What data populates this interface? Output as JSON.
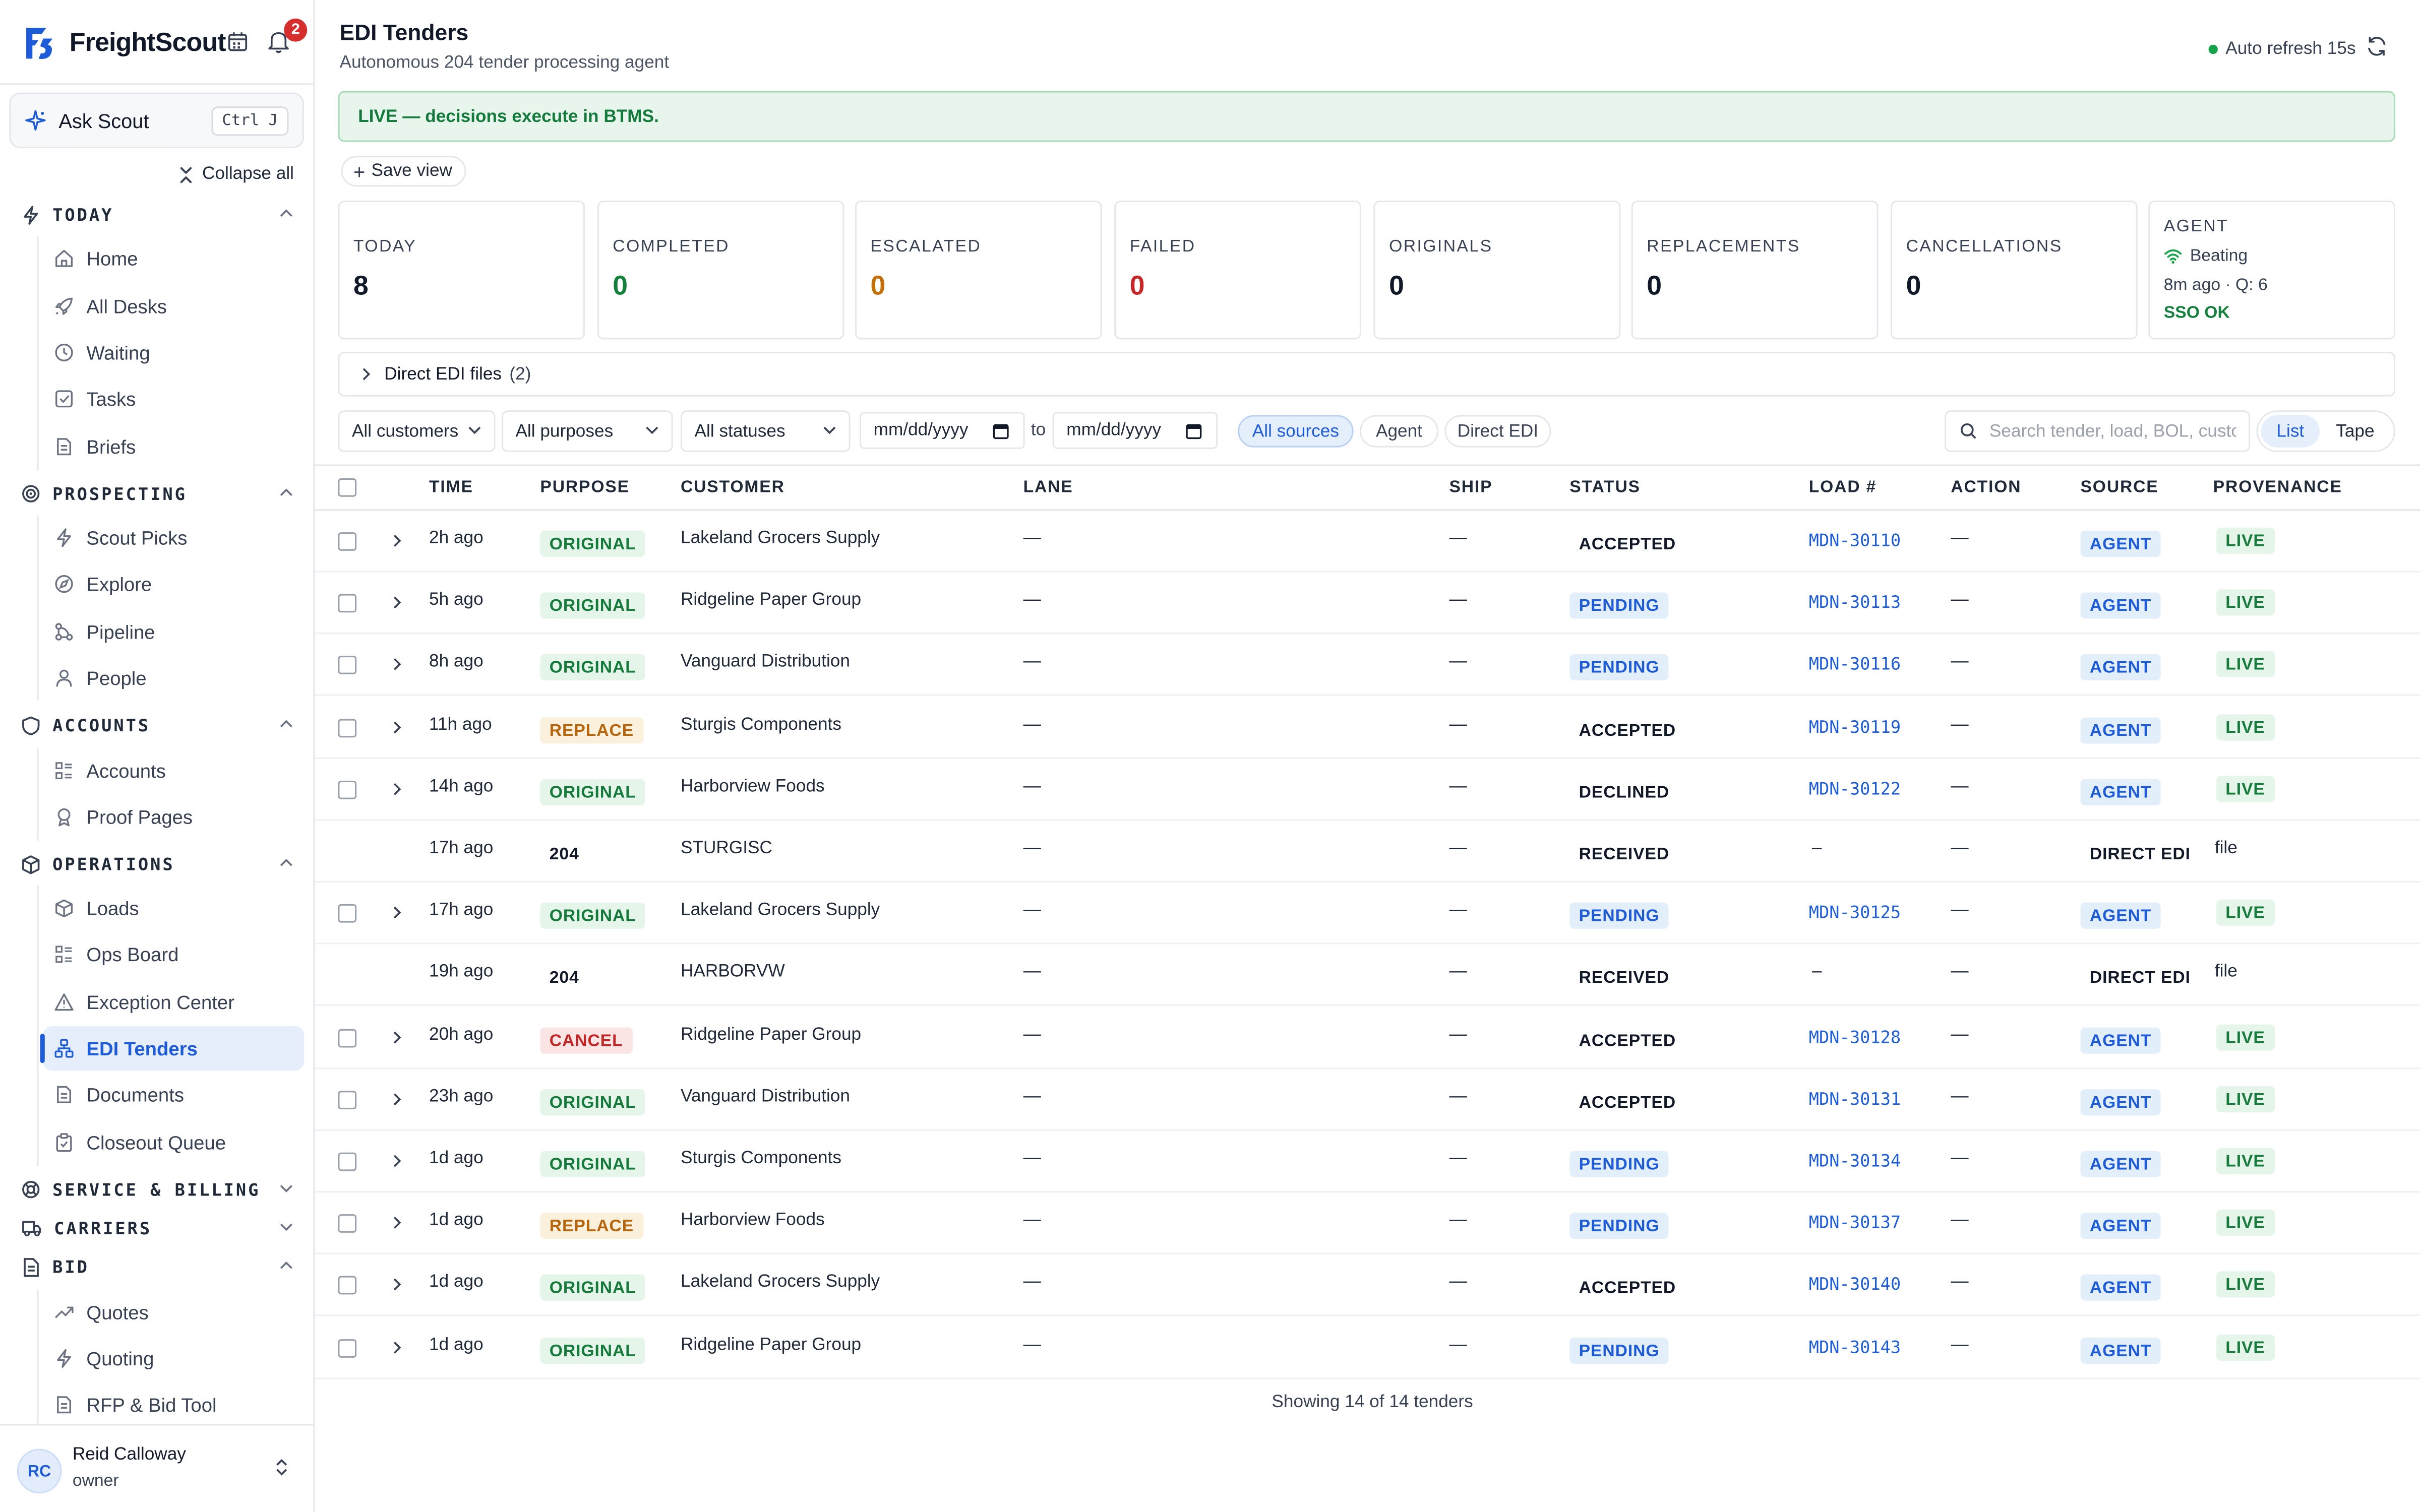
{
  "app": {
    "name": "FreightScout",
    "notification_count": "2"
  },
  "ask": {
    "label": "Ask Scout",
    "shortcut": "Ctrl J"
  },
  "sidebar": {
    "collapse_all": "Collapse all",
    "sections": {
      "today": {
        "label": "TODAY",
        "items": [
          {
            "label": "Home",
            "icon": "home-icon"
          },
          {
            "label": "All Desks",
            "icon": "rocket-icon"
          },
          {
            "label": "Waiting",
            "icon": "clock-icon"
          },
          {
            "label": "Tasks",
            "icon": "check-square-icon"
          },
          {
            "label": "Briefs",
            "icon": "file-icon"
          }
        ]
      },
      "prospecting": {
        "label": "PROSPECTING",
        "items": [
          {
            "label": "Scout Picks",
            "icon": "bolt-icon"
          },
          {
            "label": "Explore",
            "icon": "compass-icon"
          },
          {
            "label": "Pipeline",
            "icon": "pipeline-icon"
          },
          {
            "label": "People",
            "icon": "person-icon"
          }
        ]
      },
      "accounts": {
        "label": "ACCOUNTS",
        "items": [
          {
            "label": "Accounts",
            "icon": "grid-list-icon"
          },
          {
            "label": "Proof Pages",
            "icon": "award-icon"
          }
        ]
      },
      "operations": {
        "label": "OPERATIONS",
        "items": [
          {
            "label": "Loads",
            "icon": "box-icon"
          },
          {
            "label": "Ops Board",
            "icon": "grid-list-icon"
          },
          {
            "label": "Exception Center",
            "icon": "warning-icon"
          },
          {
            "label": "EDI Tenders",
            "icon": "network-icon"
          },
          {
            "label": "Documents",
            "icon": "file-icon"
          },
          {
            "label": "Closeout Queue",
            "icon": "clipboard-icon"
          }
        ]
      },
      "service_billing": {
        "label": "SERVICE & BILLING"
      },
      "carriers": {
        "label": "CARRIERS"
      },
      "bid": {
        "label": "BID",
        "items": [
          {
            "label": "Quotes",
            "icon": "trend-icon"
          },
          {
            "label": "Quoting",
            "icon": "bolt-icon"
          },
          {
            "label": "RFP & Bid Tool",
            "icon": "file-icon"
          }
        ]
      }
    }
  },
  "user": {
    "initials": "RC",
    "name": "Reid Calloway",
    "role": "owner"
  },
  "header": {
    "title": "EDI Tenders",
    "subtitle": "Autonomous 204 tender processing agent",
    "auto_refresh": "Auto refresh 15s"
  },
  "banner": {
    "text": "LIVE — decisions execute in BTMS."
  },
  "save_view": "Save view",
  "stats": [
    {
      "label": "TODAY",
      "value": "8",
      "color": "#111827"
    },
    {
      "label": "COMPLETED",
      "value": "0",
      "color": "#15803d"
    },
    {
      "label": "ESCALATED",
      "value": "0",
      "color": "#c2700c"
    },
    {
      "label": "FAILED",
      "value": "0",
      "color": "#c62828"
    },
    {
      "label": "ORIGINALS",
      "value": "0",
      "color": "#111827"
    },
    {
      "label": "REPLACEMENTS",
      "value": "0",
      "color": "#111827"
    },
    {
      "label": "CANCELLATIONS",
      "value": "0",
      "color": "#111827"
    }
  ],
  "agent_card": {
    "label": "AGENT",
    "status": "Beating",
    "meta": "8m ago · Q: 6",
    "sso": "SSO OK"
  },
  "edi_files": {
    "label": "Direct EDI files",
    "count": "(2)"
  },
  "filters": {
    "customers": "All customers",
    "purposes": "All purposes",
    "statuses": "All statuses",
    "date_from": "mm/dd/yyyy",
    "to": "to",
    "date_to": "mm/dd/yyyy",
    "sources": [
      "All sources",
      "Agent",
      "Direct EDI"
    ],
    "search_placeholder": "Search tender, load, BOL, customer",
    "views": [
      "List",
      "Tape"
    ]
  },
  "table": {
    "columns": [
      "TIME",
      "PURPOSE",
      "CUSTOMER",
      "LANE",
      "SHIP",
      "STATUS",
      "LOAD #",
      "ACTION",
      "SOURCE",
      "PROVENANCE"
    ],
    "rows": [
      {
        "time": "2h ago",
        "purpose": "ORIGINAL",
        "purpose_kind": "original",
        "customer": "Lakeland Grocers Supply",
        "lane": "—",
        "ship": "—",
        "status": "ACCEPTED",
        "status_kind": "plain",
        "load": "MDN-30110",
        "action": "—",
        "source": "AGENT",
        "source_kind": "agent",
        "provenance": "LIVE",
        "expandable": true
      },
      {
        "time": "5h ago",
        "purpose": "ORIGINAL",
        "purpose_kind": "original",
        "customer": "Ridgeline Paper Group",
        "lane": "—",
        "ship": "—",
        "status": "PENDING",
        "status_kind": "pending",
        "load": "MDN-30113",
        "action": "—",
        "source": "AGENT",
        "source_kind": "agent",
        "provenance": "LIVE",
        "expandable": true
      },
      {
        "time": "8h ago",
        "purpose": "ORIGINAL",
        "purpose_kind": "original",
        "customer": "Vanguard Distribution",
        "lane": "—",
        "ship": "—",
        "status": "PENDING",
        "status_kind": "pending",
        "load": "MDN-30116",
        "action": "—",
        "source": "AGENT",
        "source_kind": "agent",
        "provenance": "LIVE",
        "expandable": true
      },
      {
        "time": "11h ago",
        "purpose": "REPLACE",
        "purpose_kind": "replace",
        "customer": "Sturgis Components",
        "lane": "—",
        "ship": "—",
        "status": "ACCEPTED",
        "status_kind": "plain",
        "load": "MDN-30119",
        "action": "—",
        "source": "AGENT",
        "source_kind": "agent",
        "provenance": "LIVE",
        "expandable": true
      },
      {
        "time": "14h ago",
        "purpose": "ORIGINAL",
        "purpose_kind": "original",
        "customer": "Harborview Foods",
        "lane": "—",
        "ship": "—",
        "status": "DECLINED",
        "status_kind": "plain",
        "load": "MDN-30122",
        "action": "—",
        "source": "AGENT",
        "source_kind": "agent",
        "provenance": "LIVE",
        "expandable": true
      },
      {
        "time": "17h ago",
        "purpose": "204",
        "purpose_kind": "plain",
        "customer": "STURGISC",
        "lane": "—",
        "ship": "—",
        "status": "RECEIVED",
        "status_kind": "plain",
        "load": "–",
        "action": "—",
        "source": "DIRECT EDI",
        "source_kind": "direct",
        "provenance": "file",
        "expandable": false
      },
      {
        "time": "17h ago",
        "purpose": "ORIGINAL",
        "purpose_kind": "original",
        "customer": "Lakeland Grocers Supply",
        "lane": "—",
        "ship": "—",
        "status": "PENDING",
        "status_kind": "pending",
        "load": "MDN-30125",
        "action": "—",
        "source": "AGENT",
        "source_kind": "agent",
        "provenance": "LIVE",
        "expandable": true
      },
      {
        "time": "19h ago",
        "purpose": "204",
        "purpose_kind": "plain",
        "customer": "HARBORVW",
        "lane": "—",
        "ship": "—",
        "status": "RECEIVED",
        "status_kind": "plain",
        "load": "–",
        "action": "—",
        "source": "DIRECT EDI",
        "source_kind": "direct",
        "provenance": "file",
        "expandable": false
      },
      {
        "time": "20h ago",
        "purpose": "CANCEL",
        "purpose_kind": "cancel",
        "customer": "Ridgeline Paper Group",
        "lane": "—",
        "ship": "—",
        "status": "ACCEPTED",
        "status_kind": "plain",
        "load": "MDN-30128",
        "action": "—",
        "source": "AGENT",
        "source_kind": "agent",
        "provenance": "LIVE",
        "expandable": true
      },
      {
        "time": "23h ago",
        "purpose": "ORIGINAL",
        "purpose_kind": "original",
        "customer": "Vanguard Distribution",
        "lane": "—",
        "ship": "—",
        "status": "ACCEPTED",
        "status_kind": "plain",
        "load": "MDN-30131",
        "action": "—",
        "source": "AGENT",
        "source_kind": "agent",
        "provenance": "LIVE",
        "expandable": true
      },
      {
        "time": "1d ago",
        "purpose": "ORIGINAL",
        "purpose_kind": "original",
        "customer": "Sturgis Components",
        "lane": "—",
        "ship": "—",
        "status": "PENDING",
        "status_kind": "pending",
        "load": "MDN-30134",
        "action": "—",
        "source": "AGENT",
        "source_kind": "agent",
        "provenance": "LIVE",
        "expandable": true
      },
      {
        "time": "1d ago",
        "purpose": "REPLACE",
        "purpose_kind": "replace",
        "customer": "Harborview Foods",
        "lane": "—",
        "ship": "—",
        "status": "PENDING",
        "status_kind": "pending",
        "load": "MDN-30137",
        "action": "—",
        "source": "AGENT",
        "source_kind": "agent",
        "provenance": "LIVE",
        "expandable": true
      },
      {
        "time": "1d ago",
        "purpose": "ORIGINAL",
        "purpose_kind": "original",
        "customer": "Lakeland Grocers Supply",
        "lane": "—",
        "ship": "—",
        "status": "ACCEPTED",
        "status_kind": "plain",
        "load": "MDN-30140",
        "action": "—",
        "source": "AGENT",
        "source_kind": "agent",
        "provenance": "LIVE",
        "expandable": true
      },
      {
        "time": "1d ago",
        "purpose": "ORIGINAL",
        "purpose_kind": "original",
        "customer": "Ridgeline Paper Group",
        "lane": "—",
        "ship": "—",
        "status": "PENDING",
        "status_kind": "pending",
        "load": "MDN-30143",
        "action": "—",
        "source": "AGENT",
        "source_kind": "agent",
        "provenance": "LIVE",
        "expandable": true
      }
    ],
    "footer": "Showing 14 of 14 tenders"
  },
  "colors": {
    "accent": "#1d5cd6",
    "success": "#15803d",
    "warning": "#c2700c",
    "danger": "#c62828"
  }
}
